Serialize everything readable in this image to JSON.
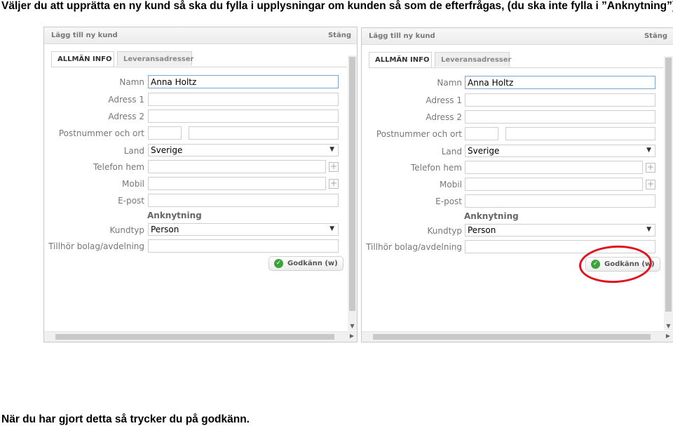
{
  "captions": {
    "top": "Väljer du att upprätta en ny kund så ska du fylla i upplysningar om kunden så som de efterfrågas, (du ska inte fylla i ”Anknytning”):",
    "bottom": "När du har gjort detta så trycker du på godkänn."
  },
  "dialog": {
    "title": "Lägg till ny kund",
    "close_label": "Stäng",
    "tabs": [
      "ALLMÄN INFO",
      "Leveransadresser"
    ],
    "fields": {
      "namn_label": "Namn",
      "namn_value": "Anna Holtz",
      "adress1_label": "Adress 1",
      "adress2_label": "Adress 2",
      "postnummer_label": "Postnummer och ort",
      "land_label": "Land",
      "land_value": "Sverige",
      "telefon_label": "Telefon hem",
      "mobil_label": "Mobil",
      "epost_label": "E-post",
      "anknytning_heading": "Anknytning",
      "kundtyp_label": "Kundtyp",
      "kundtyp_value": "Person",
      "tillhor_label": "Tillhör bolag/avdelning"
    },
    "approve_label": "Godkänn (w)"
  },
  "colors": {
    "highlight_circle": "#e0141e",
    "approve_icon": "#3aa33a"
  },
  "icons": {
    "approve": "check-circle-icon",
    "add": "plus-square-icon",
    "dropdown": "caret-down-icon"
  }
}
